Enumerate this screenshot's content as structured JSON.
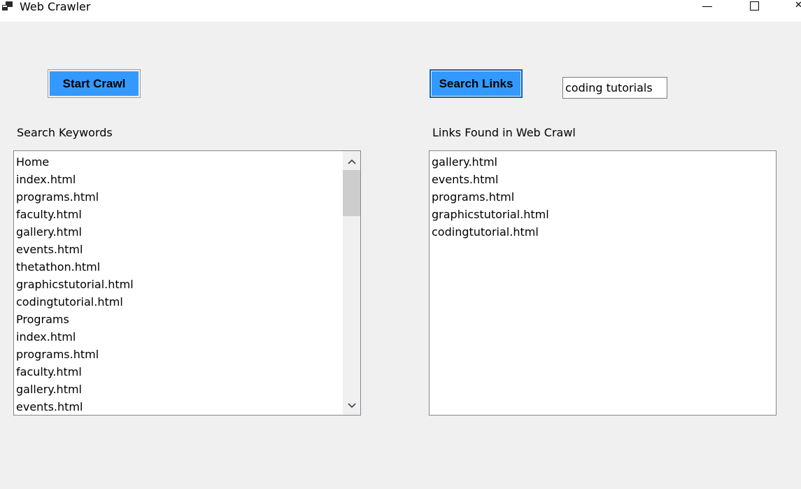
{
  "window": {
    "title": "Web Crawler",
    "app_icon": "app-window-icon",
    "controls": {
      "minimize_icon": "minimize-icon",
      "maximize_icon": "maximize-icon",
      "close_icon": "close-icon"
    }
  },
  "toolbar": {
    "start_crawl_label": "Start Crawl",
    "search_links_label": "Search Links",
    "search_value": "coding tutorials"
  },
  "keywords": {
    "label": "Search Keywords",
    "items": [
      "Home",
      "index.html",
      "programs.html",
      "faculty.html",
      "gallery.html",
      "events.html",
      "thetathon.html",
      "graphicstutorial.html",
      "codingtutorial.html",
      "Programs",
      "index.html",
      "programs.html",
      "faculty.html",
      "gallery.html",
      "events.html"
    ],
    "scrollbar": {
      "up_icon": "chevron-up-icon",
      "down_icon": "chevron-down-icon"
    }
  },
  "links": {
    "label": "Links Found in Web Crawl",
    "items": [
      "gallery.html",
      "events.html",
      "programs.html",
      "graphicstutorial.html",
      "codingtutorial.html"
    ]
  },
  "colors": {
    "button_accent": "#3399ff",
    "focus_border": "#0a64c8",
    "window_background": "#f0f0f0"
  }
}
